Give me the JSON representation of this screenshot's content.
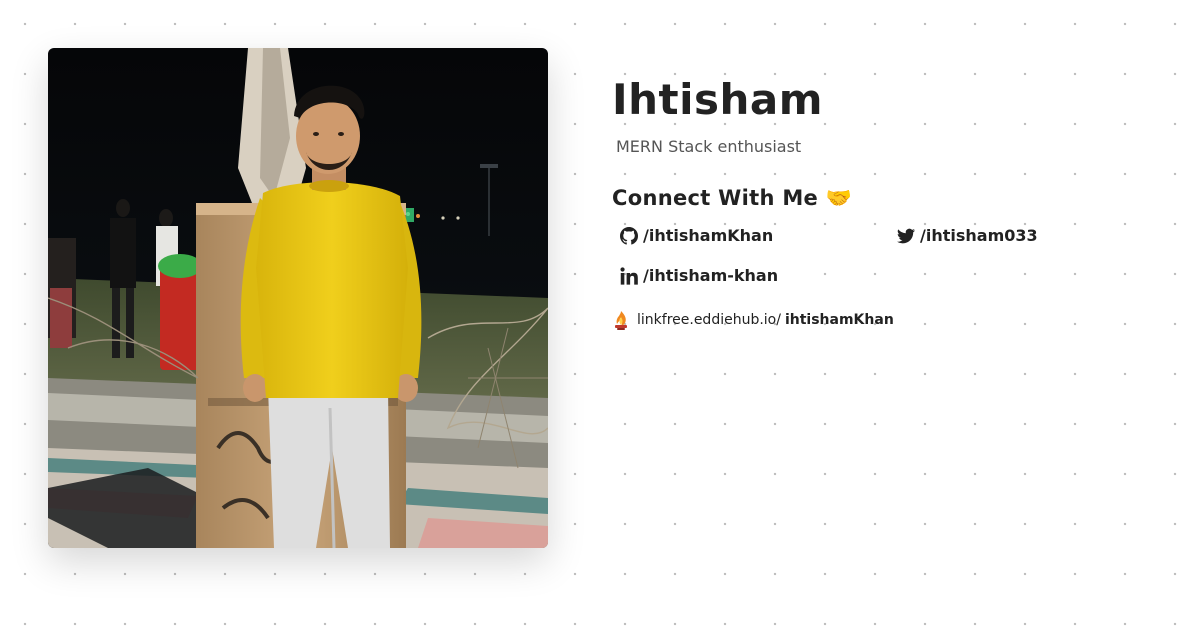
{
  "profile": {
    "name": "Ihtisham",
    "bio": "MERN Stack enthusiast",
    "photo_alt": "photo-of-ihtisham"
  },
  "connect": {
    "heading": "Connect With Me 🤝",
    "links": [
      {
        "icon": "github-icon",
        "label": "/ihtishamKhan"
      },
      {
        "icon": "twitter-icon",
        "label": "/ihtisham033"
      },
      {
        "icon": "linkedin-icon",
        "label": "/ihtisham-khan"
      }
    ]
  },
  "linkfree": {
    "icon": "linkfree-icon",
    "prefix": "linkfree.eddiehub.io/",
    "username": "ihtishamKhan"
  },
  "colors": {
    "text": "#222222",
    "muted": "#555555",
    "shirt": "#e8c614",
    "background_dots": "#b9b9b9"
  }
}
